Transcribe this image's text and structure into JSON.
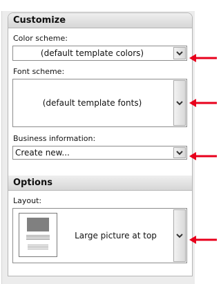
{
  "customize": {
    "header": "Customize",
    "color_scheme": {
      "label": "Color scheme:",
      "value": "(default template colors)"
    },
    "font_scheme": {
      "label": "Font scheme:",
      "value": "(default template fonts)"
    },
    "business_info": {
      "label": "Business information:",
      "value": "Create new..."
    }
  },
  "options": {
    "header": "Options",
    "layout": {
      "label": "Layout:",
      "value": "Large picture at top",
      "thumbnail_icon": "large-picture-layout-icon"
    }
  },
  "colors": {
    "arrow": "#e8001c",
    "header_gradient_top": "#efefef",
    "header_gradient_bottom": "#d6d6d6",
    "pane_background": "#ececec"
  },
  "icons": {
    "dropdown": "chevron-down-icon",
    "annotation": "red-arrow-icon"
  }
}
